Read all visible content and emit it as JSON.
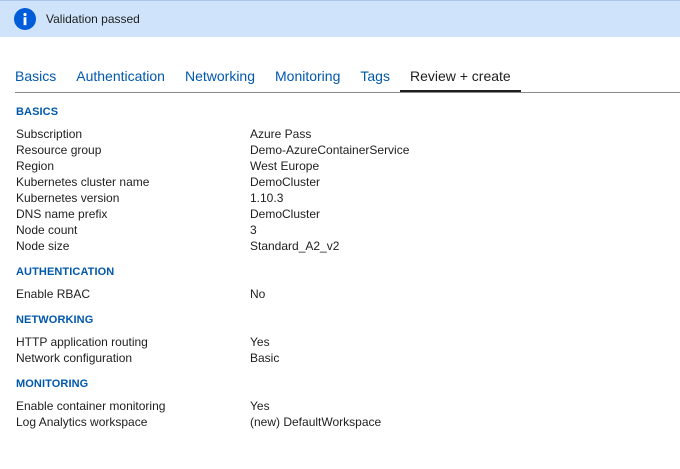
{
  "banner": {
    "text": "Validation passed",
    "icon": "info-icon",
    "color": "#cfe4fa"
  },
  "tabs": [
    {
      "label": "Basics"
    },
    {
      "label": "Authentication"
    },
    {
      "label": "Networking"
    },
    {
      "label": "Monitoring"
    },
    {
      "label": "Tags"
    },
    {
      "label": "Review + create",
      "active": true
    }
  ],
  "sections": {
    "basics": {
      "title": "BASICS",
      "rows": [
        {
          "label": "Subscription",
          "value": "Azure Pass"
        },
        {
          "label": "Resource group",
          "value": "Demo-AzureContainerService"
        },
        {
          "label": "Region",
          "value": "West Europe"
        },
        {
          "label": "Kubernetes cluster name",
          "value": "DemoCluster"
        },
        {
          "label": "Kubernetes version",
          "value": "1.10.3"
        },
        {
          "label": "DNS name prefix",
          "value": "DemoCluster"
        },
        {
          "label": "Node count",
          "value": "3"
        },
        {
          "label": "Node size",
          "value": "Standard_A2_v2"
        }
      ]
    },
    "authentication": {
      "title": "AUTHENTICATION",
      "rows": [
        {
          "label": "Enable RBAC",
          "value": "No"
        }
      ]
    },
    "networking": {
      "title": "NETWORKING",
      "rows": [
        {
          "label": "HTTP application routing",
          "value": "Yes"
        },
        {
          "label": "Network configuration",
          "value": "Basic"
        }
      ]
    },
    "monitoring": {
      "title": "MONITORING",
      "rows": [
        {
          "label": "Enable container monitoring",
          "value": "Yes"
        },
        {
          "label": "Log Analytics workspace",
          "value": "(new) DefaultWorkspace"
        }
      ]
    }
  },
  "colors": {
    "accent": "#0058ad",
    "info_icon": "#015cda"
  }
}
